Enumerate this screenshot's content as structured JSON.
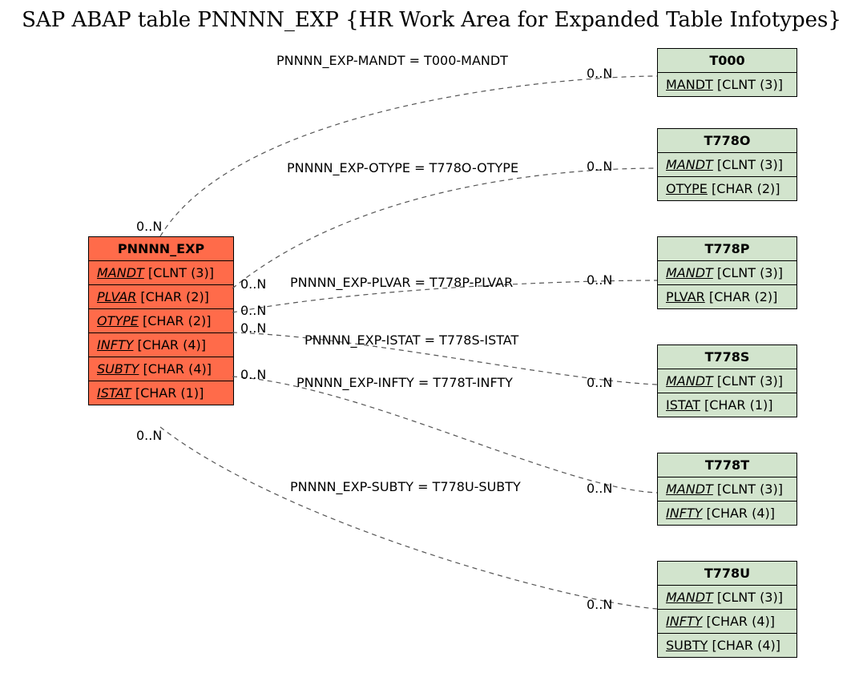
{
  "title": "SAP ABAP table PNNNN_EXP {HR Work Area for Expanded Table Infotypes}",
  "mainEntity": {
    "name": "PNNNN_EXP",
    "fields": [
      {
        "name": "MANDT",
        "type": "[CLNT (3)]",
        "italic": true
      },
      {
        "name": "PLVAR",
        "type": "[CHAR (2)]",
        "italic": true
      },
      {
        "name": "OTYPE",
        "type": "[CHAR (2)]",
        "italic": true
      },
      {
        "name": "INFTY",
        "type": "[CHAR (4)]",
        "italic": true
      },
      {
        "name": "SUBTY",
        "type": "[CHAR (4)]",
        "italic": true
      },
      {
        "name": "ISTAT",
        "type": "[CHAR (1)]",
        "italic": true
      }
    ]
  },
  "entities": [
    {
      "name": "T000",
      "fields": [
        {
          "name": "MANDT",
          "type": "[CLNT (3)]",
          "italic": false
        }
      ]
    },
    {
      "name": "T778O",
      "fields": [
        {
          "name": "MANDT",
          "type": "[CLNT (3)]",
          "italic": true
        },
        {
          "name": "OTYPE",
          "type": "[CHAR (2)]",
          "italic": false
        }
      ]
    },
    {
      "name": "T778P",
      "fields": [
        {
          "name": "MANDT",
          "type": "[CLNT (3)]",
          "italic": true
        },
        {
          "name": "PLVAR",
          "type": "[CHAR (2)]",
          "italic": false
        }
      ]
    },
    {
      "name": "T778S",
      "fields": [
        {
          "name": "MANDT",
          "type": "[CLNT (3)]",
          "italic": true
        },
        {
          "name": "ISTAT",
          "type": "[CHAR (1)]",
          "italic": false
        }
      ]
    },
    {
      "name": "T778T",
      "fields": [
        {
          "name": "MANDT",
          "type": "[CLNT (3)]",
          "italic": true
        },
        {
          "name": "INFTY",
          "type": "[CHAR (4)]",
          "italic": true
        }
      ]
    },
    {
      "name": "T778U",
      "fields": [
        {
          "name": "MANDT",
          "type": "[CLNT (3)]",
          "italic": true
        },
        {
          "name": "INFTY",
          "type": "[CHAR (4)]",
          "italic": true
        },
        {
          "name": "SUBTY",
          "type": "[CHAR (4)]",
          "italic": false
        }
      ]
    }
  ],
  "edges": [
    {
      "label": "PNNNN_EXP-MANDT = T000-MANDT",
      "leftCard": "0..N",
      "rightCard": "0..N"
    },
    {
      "label": "PNNNN_EXP-OTYPE = T778O-OTYPE",
      "leftCard": "0..N",
      "rightCard": "0..N"
    },
    {
      "label": "PNNNN_EXP-PLVAR = T778P-PLVAR",
      "leftCard": "0..N",
      "rightCard": "0..N"
    },
    {
      "label": "PNNNN_EXP-ISTAT = T778S-ISTAT",
      "leftCard": "0..N",
      "rightCard": "0..N"
    },
    {
      "label": "PNNNN_EXP-INFTY = T778T-INFTY",
      "leftCard": "0..N",
      "rightCard": "0..N"
    },
    {
      "label": "PNNNN_EXP-SUBTY = T778U-SUBTY",
      "leftCard": "0..N",
      "rightCard": "0..N"
    }
  ]
}
